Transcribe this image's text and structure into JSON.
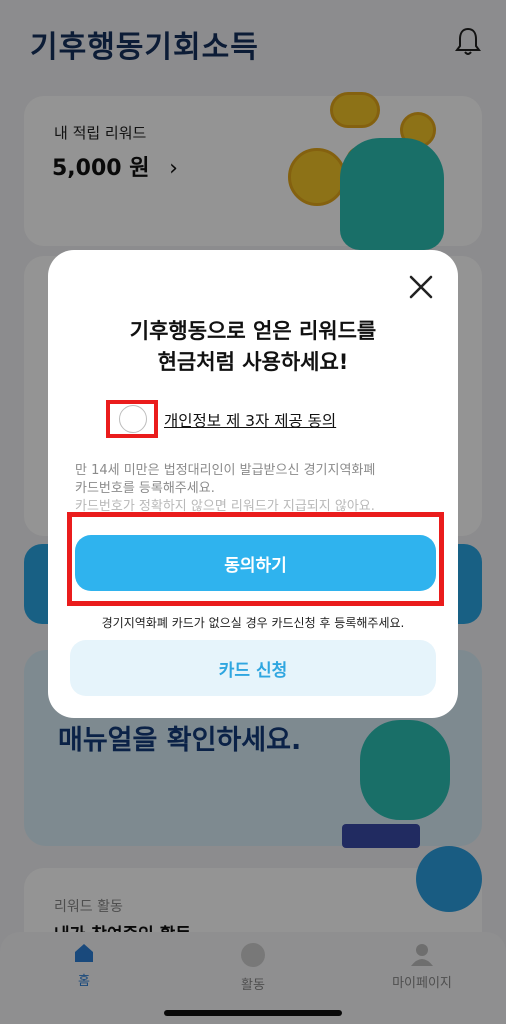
{
  "app": {
    "logo_text": "기후행동기회소득"
  },
  "reward_card": {
    "title": "내 적립 리워드",
    "amount": "5,000 원",
    "chevron": "›"
  },
  "manual_card": {
    "text": "매뉴얼을 확인하세요."
  },
  "activity_card": {
    "title": "리워드 활동",
    "subtitle": "내가 참여중인 활동"
  },
  "tabbar": {
    "items": [
      {
        "label": "홈",
        "icon": "home-icon",
        "active": true
      },
      {
        "label": "활동",
        "icon": "activity-icon",
        "active": false
      },
      {
        "label": "마이페이지",
        "icon": "person-icon",
        "active": false
      }
    ]
  },
  "modal": {
    "title_line1": "기후행동으로 얻은 리워드를",
    "title_line2": "현금처럼 사용하세요!",
    "consent_label": "개인정보 제 3자 제공 동의",
    "notice_line1": "만 14세 미만은 법정대리인이 발급받으신 경기지역화폐",
    "notice_line2": "카드번호를 등록해주세요.",
    "notice_line3": "카드번호가 정확하지 않으면 리워드가 지급되지 않아요.",
    "agree_button": "동의하기",
    "hint": "경기지역화폐 카드가 없으실 경우 카드신청 후 등록해주세요.",
    "apply_button": "카드 신청"
  },
  "colors": {
    "accent": "#2fb3ee",
    "highlight": "#ea1c1c",
    "brand_navy": "#16315e"
  }
}
